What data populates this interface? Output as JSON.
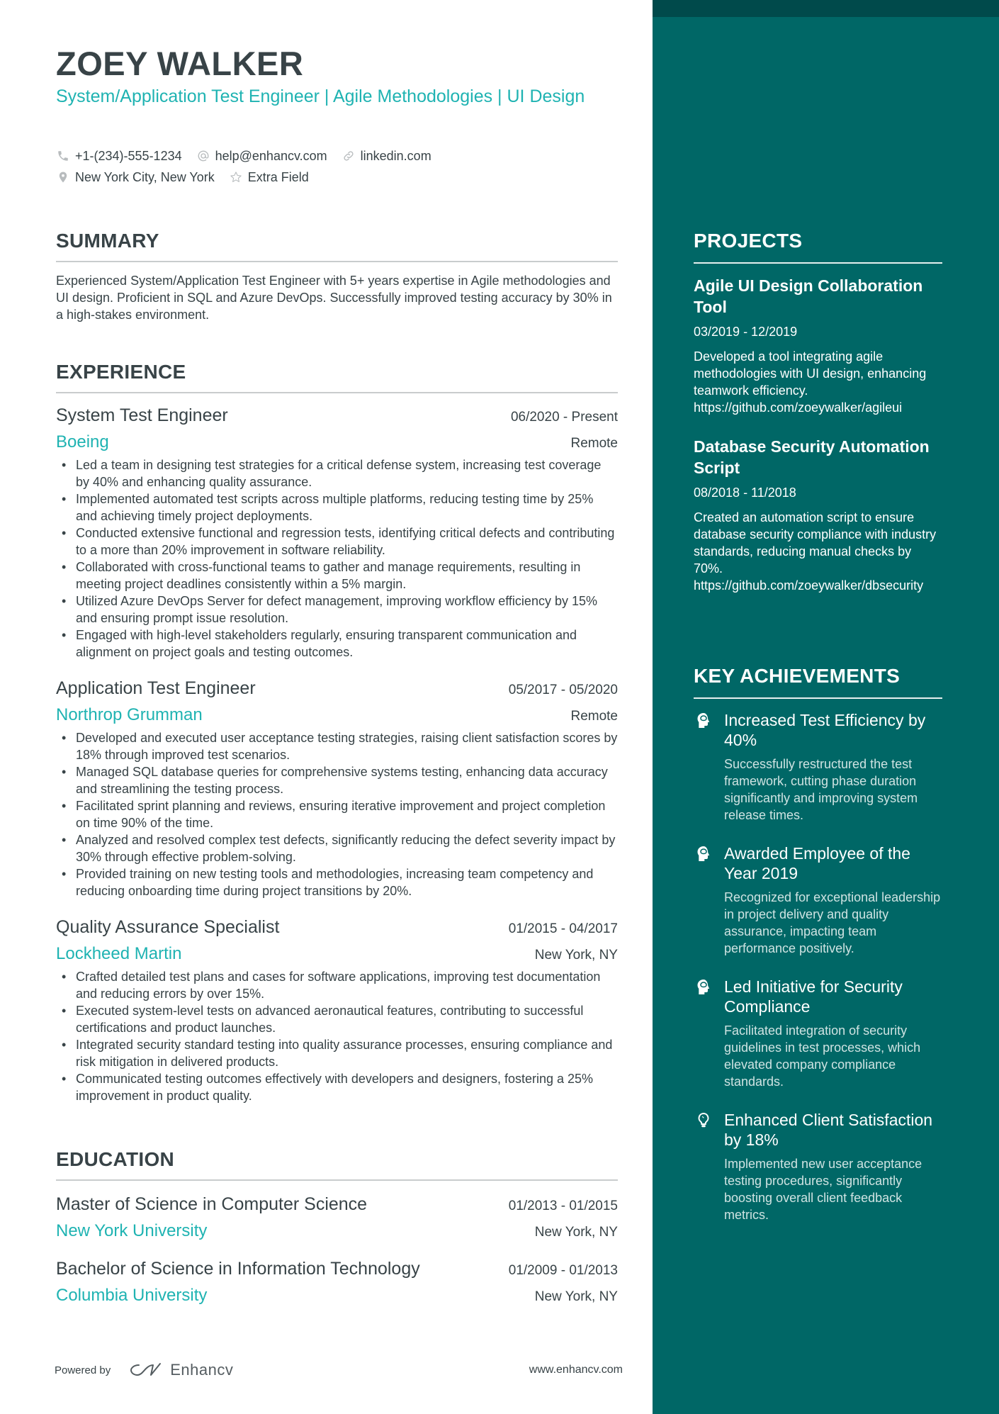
{
  "header": {
    "name": "ZOEY WALKER",
    "headline": "System/Application Test Engineer | Agile Methodologies | UI Design",
    "contacts": [
      {
        "icon": "phone-icon",
        "text": "+1-(234)-555-1234"
      },
      {
        "icon": "at-icon",
        "text": "help@enhancv.com"
      },
      {
        "icon": "link-icon",
        "text": "linkedin.com"
      },
      {
        "icon": "location-pin-icon",
        "text": "New York City, New York"
      },
      {
        "icon": "star-icon",
        "text": "Extra Field"
      }
    ]
  },
  "summary": {
    "title": "SUMMARY",
    "text": "Experienced System/Application Test Engineer with 5+ years expertise in Agile methodologies and UI design. Proficient in SQL and Azure DevOps. Successfully improved testing accuracy by 30% in a high-stakes environment."
  },
  "experience": {
    "title": "EXPERIENCE",
    "jobs": [
      {
        "title": "System Test Engineer",
        "dates": "06/2020 - Present",
        "company": "Boeing",
        "location": "Remote",
        "bullets": [
          "Led a team in designing test strategies for a critical defense system, increasing test coverage by 40% and enhancing quality assurance.",
          "Implemented automated test scripts across multiple platforms, reducing testing time by 25% and achieving timely project deployments.",
          "Conducted extensive functional and regression tests, identifying critical defects and contributing to a more than 20% improvement in software reliability.",
          "Collaborated with cross-functional teams to gather and manage requirements, resulting in meeting project deadlines consistently within a 5% margin.",
          "Utilized Azure DevOps Server for defect management, improving workflow efficiency by 15% and ensuring prompt issue resolution.",
          "Engaged with high-level stakeholders regularly, ensuring transparent communication and alignment on project goals and testing outcomes."
        ]
      },
      {
        "title": "Application Test Engineer",
        "dates": "05/2017 - 05/2020",
        "company": "Northrop Grumman",
        "location": "Remote",
        "bullets": [
          "Developed and executed user acceptance testing strategies, raising client satisfaction scores by 18% through improved test scenarios.",
          "Managed SQL database queries for comprehensive systems testing, enhancing data accuracy and streamlining the testing process.",
          "Facilitated sprint planning and reviews, ensuring iterative improvement and project completion on time 90% of the time.",
          "Analyzed and resolved complex test defects, significantly reducing the defect severity impact by 30% through effective problem-solving.",
          "Provided training on new testing tools and methodologies, increasing team competency and reducing onboarding time during project transitions by 20%."
        ]
      },
      {
        "title": "Quality Assurance Specialist",
        "dates": "01/2015 - 04/2017",
        "company": "Lockheed Martin",
        "location": "New York, NY",
        "bullets": [
          "Crafted detailed test plans and cases for software applications, improving test documentation and reducing errors by over 15%.",
          "Executed system-level tests on advanced aeronautical features, contributing to successful certifications and product launches.",
          "Integrated security standard testing into quality assurance processes, ensuring compliance and risk mitigation in delivered products.",
          "Communicated testing outcomes effectively with developers and designers, fostering a 25% improvement in product quality."
        ]
      }
    ]
  },
  "education": {
    "title": "EDUCATION",
    "items": [
      {
        "degree": "Master of Science in Computer Science",
        "dates": "01/2013 - 01/2015",
        "school": "New York University",
        "location": "New York, NY"
      },
      {
        "degree": "Bachelor of Science in Information Technology",
        "dates": "01/2009 - 01/2013",
        "school": "Columbia University",
        "location": "New York, NY"
      }
    ]
  },
  "projects": {
    "title": "PROJECTS",
    "items": [
      {
        "title": "Agile UI Design Collaboration Tool",
        "dates": "03/2019 - 12/2019",
        "description": "Developed a tool integrating agile methodologies with UI design, enhancing teamwork efficiency.",
        "link": "https://github.com/zoeywalker/agileui"
      },
      {
        "title": "Database Security Automation Script",
        "dates": "08/2018 - 11/2018",
        "description": "Created an automation script to ensure database security compliance with industry standards, reducing manual checks by 70%.",
        "link": "https://github.com/zoeywalker/dbsecurity"
      }
    ]
  },
  "achievements": {
    "title": "KEY ACHIEVEMENTS",
    "items": [
      {
        "icon": "head-brain-icon",
        "title": "Increased Test Efficiency by 40%",
        "description": "Successfully restructured the test framework, cutting phase duration significantly and improving system release times."
      },
      {
        "icon": "head-brain-icon",
        "title": "Awarded Employee of the Year 2019",
        "description": "Recognized for exceptional leadership in project delivery and quality assurance, impacting team performance positively."
      },
      {
        "icon": "head-brain-icon",
        "title": "Led Initiative for Security Compliance",
        "description": "Facilitated integration of security guidelines in test processes, which elevated company compliance standards."
      },
      {
        "icon": "lightbulb-icon",
        "title": "Enhanced Client Satisfaction by 18%",
        "description": "Implemented new user acceptance testing procedures, significantly boosting overall client feedback metrics."
      }
    ]
  },
  "footer": {
    "powered_by": "Powered by",
    "brand": "Enhancv",
    "website": "www.enhancv.com"
  },
  "colors": {
    "accent": "#1fb3b2",
    "text": "#384347",
    "sidebar": "#006766",
    "sidebar_top": "#004a4b"
  }
}
